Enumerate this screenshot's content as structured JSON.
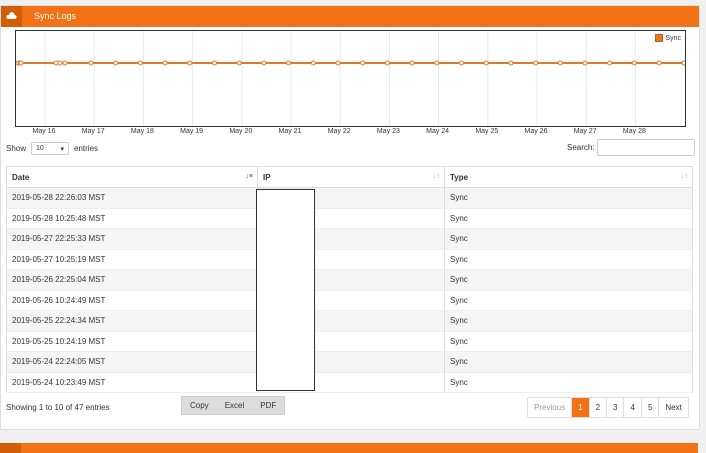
{
  "panel": {
    "title": "Sync Logs",
    "icon": "cloud-icon",
    "accent": "#f47216"
  },
  "chart_data": {
    "type": "line",
    "legend": "top-right",
    "series": [
      {
        "name": "Sync",
        "color": "#e07a2a"
      }
    ],
    "x_ticks": [
      "May 16",
      "May 17",
      "May 18",
      "May 19",
      "May 20",
      "May 21",
      "May 22",
      "May 23",
      "May 24",
      "May 25",
      "May 26",
      "May 27",
      "May 28"
    ],
    "x_range": [
      "2019-05-15",
      "2019-05-29"
    ]
  },
  "controls": {
    "show_label": "Show",
    "entries_label": "entries",
    "page_size": "10",
    "search_label": "Search:"
  },
  "table": {
    "columns": [
      "Date",
      "IP",
      "Type"
    ],
    "rows": [
      [
        "2019-05-28 22:26:03 MST",
        "",
        "Sync"
      ],
      [
        "2019-05-28 10:25:48 MST",
        "",
        "Sync"
      ],
      [
        "2019-05-27 22:25:33 MST",
        "",
        "Sync"
      ],
      [
        "2019-05-27 10:25:19 MST",
        "",
        "Sync"
      ],
      [
        "2019-05-26 22:25:04 MST",
        "",
        "Sync"
      ],
      [
        "2019-05-26 10:24:49 MST",
        "",
        "Sync"
      ],
      [
        "2019-05-25 22:24:34 MST",
        "",
        "Sync"
      ],
      [
        "2019-05-25 10:24:19 MST",
        "",
        "Sync"
      ],
      [
        "2019-05-24 22:24:05 MST",
        "",
        "Sync"
      ],
      [
        "2019-05-24 10:23:49 MST",
        "",
        "Sync"
      ]
    ]
  },
  "footer": {
    "info": "Showing 1 to 10 of 47 entries",
    "export_buttons": [
      "Copy",
      "Excel",
      "PDF"
    ],
    "pager": [
      "Previous",
      "1",
      "2",
      "3",
      "4",
      "5",
      "Next"
    ],
    "current_page": "1"
  }
}
